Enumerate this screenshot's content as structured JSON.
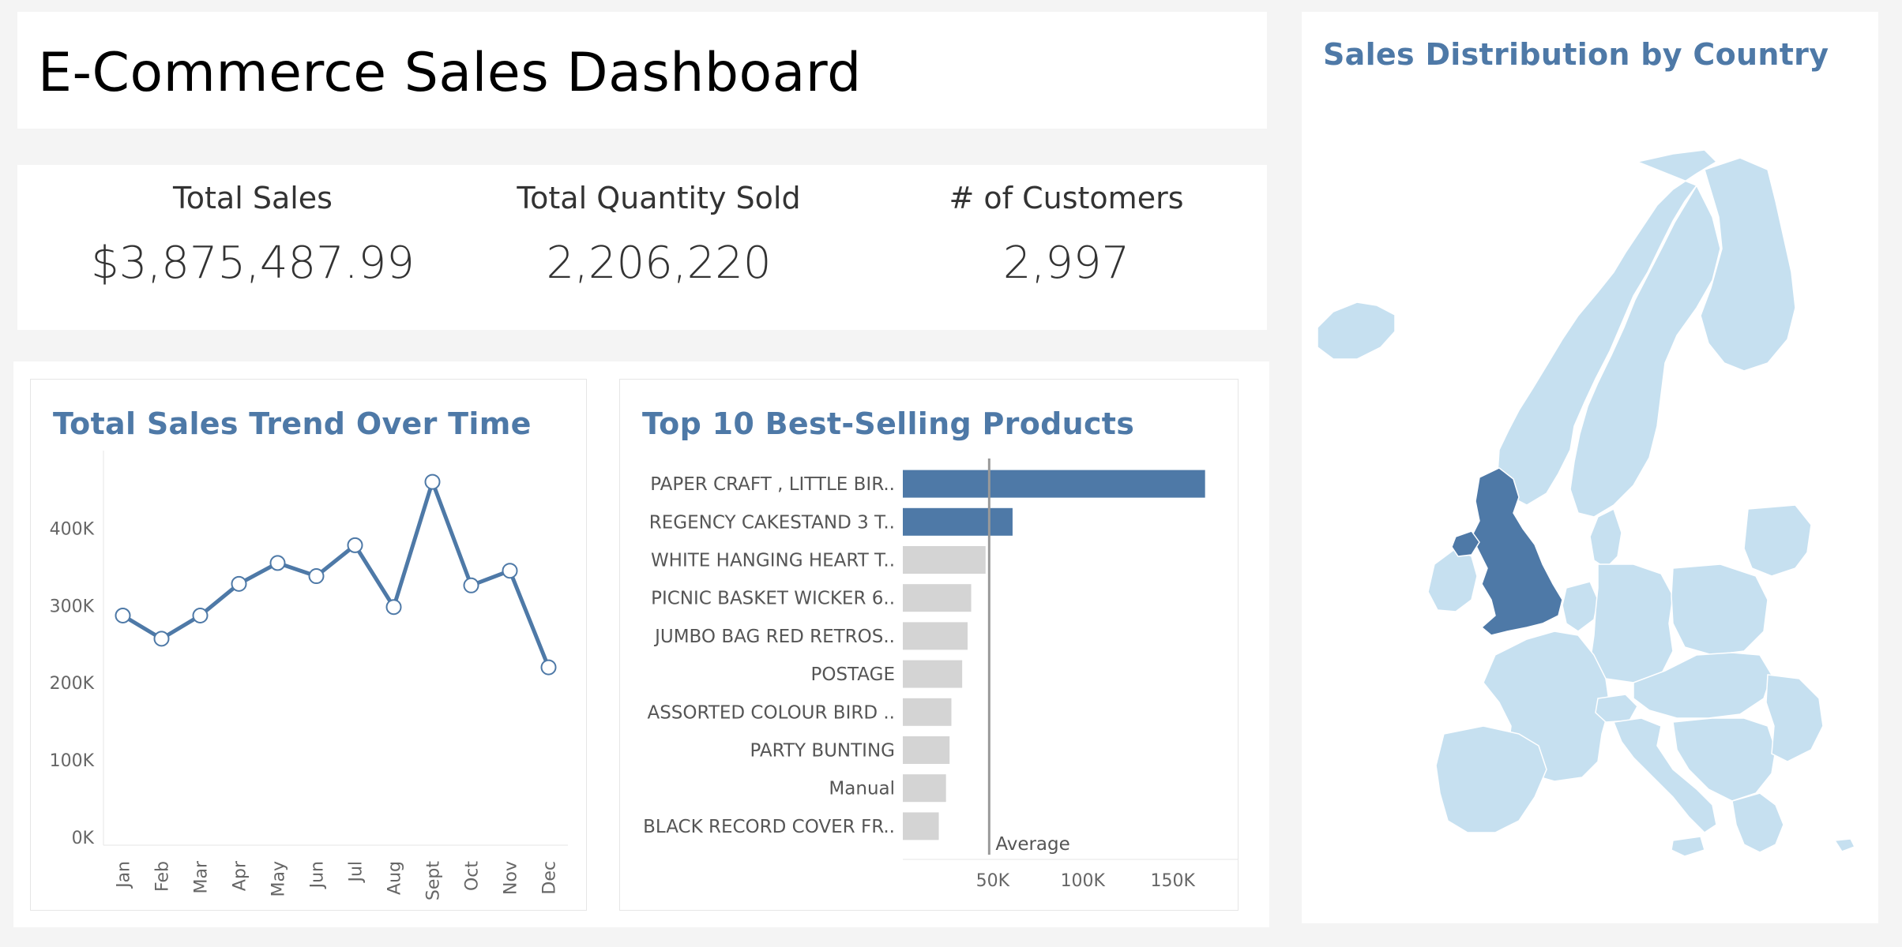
{
  "header": {
    "title": "E-Commerce Sales Dashboard"
  },
  "kpis": [
    {
      "label": "Total Sales",
      "value": "$3,875,487.99"
    },
    {
      "label": "Total Quantity Sold",
      "value": "2,206,220"
    },
    {
      "label": "# of Customers",
      "value": "2,997"
    }
  ],
  "trend": {
    "title": "Total Sales Trend Over Time",
    "color": "#4e79a7"
  },
  "top10": {
    "title": "Top 10 Best-Selling Products",
    "average_label": "Average",
    "highlight_color": "#4e79a7",
    "bar_color": "#d4d4d4"
  },
  "map": {
    "title": "Sales Distribution by Country",
    "highlight_country": "United Kingdom",
    "highlight_color": "#4e79a7",
    "base_color": "#c6e0f0"
  },
  "chart_data": [
    {
      "type": "line",
      "title": "Total Sales Trend Over Time",
      "x": [
        "Jan",
        "Feb",
        "Mar",
        "Apr",
        "May",
        "Jun",
        "Jul",
        "Aug",
        "Sept",
        "Oct",
        "Nov",
        "Dec"
      ],
      "values": [
        287000,
        257000,
        287000,
        328000,
        355000,
        338000,
        378000,
        298000,
        460000,
        326000,
        345000,
        220000
      ],
      "ylim": [
        0,
        480000
      ],
      "yticks": [
        0,
        100000,
        200000,
        300000,
        400000
      ],
      "ytick_labels": [
        "0K",
        "100K",
        "200K",
        "300K",
        "400K"
      ],
      "grid": false
    },
    {
      "type": "bar",
      "orientation": "horizontal",
      "title": "Top 10 Best-Selling Products",
      "categories": [
        "PAPER CRAFT , LITTLE BIR..",
        "REGENCY CAKESTAND 3 T..",
        "WHITE HANGING HEART T..",
        "PICNIC BASKET WICKER 6..",
        "JUMBO BAG RED RETROS..",
        "POSTAGE",
        "ASSORTED COLOUR BIRD ..",
        "PARTY BUNTING",
        "Manual",
        "BLACK RECORD COVER FR.."
      ],
      "values": [
        168000,
        61000,
        46000,
        38000,
        36000,
        33000,
        27000,
        26000,
        24000,
        20000
      ],
      "highlighted": [
        true,
        true,
        false,
        false,
        false,
        false,
        false,
        false,
        false,
        false
      ],
      "average": 48000,
      "xlim": [
        0,
        180000
      ],
      "xticks": [
        50000,
        100000,
        150000
      ],
      "xtick_labels": [
        "50K",
        "100K",
        "150K"
      ]
    }
  ]
}
